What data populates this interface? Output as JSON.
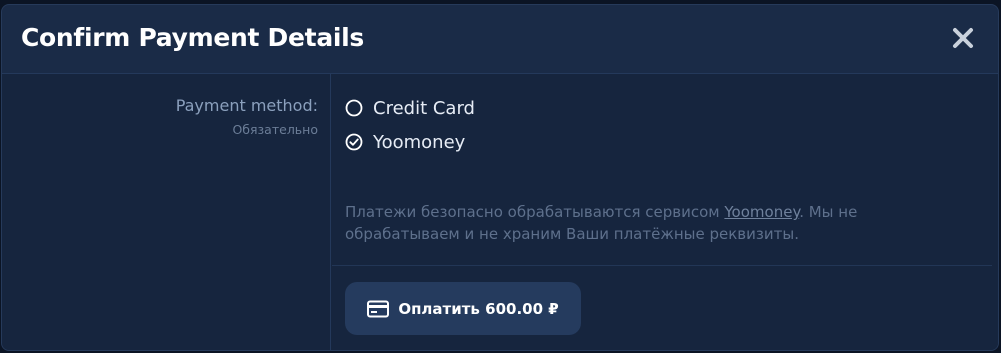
{
  "dialog": {
    "title": "Confirm Payment Details",
    "close_icon": "close-icon"
  },
  "payment_method": {
    "label": "Payment method:",
    "hint": "Обязательно",
    "options": [
      {
        "label": "Credit Card",
        "selected": false,
        "icon": "radio-unchecked-icon"
      },
      {
        "label": "Yoomoney",
        "selected": true,
        "icon": "radio-checked-icon"
      }
    ]
  },
  "notice": {
    "before": "Платежи безопасно обрабатываются сервисом ",
    "link": "Yoomoney",
    "after": ". Мы не обрабатываем и не храним Ваши платёжные реквизиты."
  },
  "pay_button": {
    "label": "Оплатить 600.00 ₽",
    "icon": "credit-card-icon"
  },
  "colors": {
    "background": "#0b1424",
    "dialog": "#1a2b47",
    "button": "#253b5e"
  }
}
